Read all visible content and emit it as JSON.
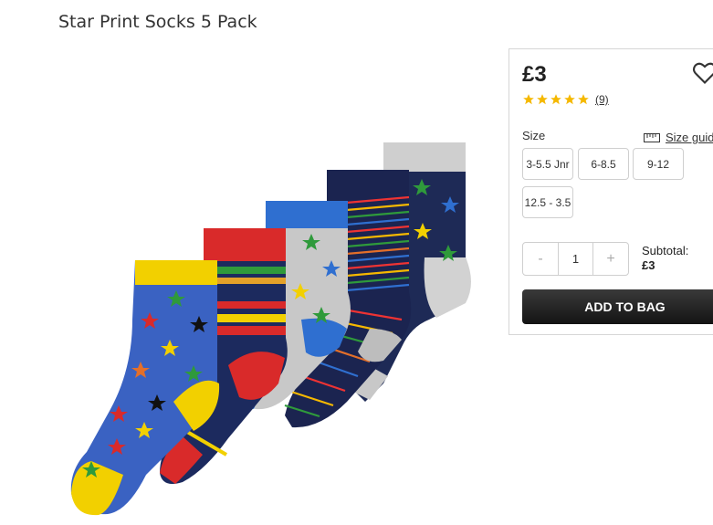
{
  "product": {
    "title": "Star Print Socks 5 Pack"
  },
  "purchase": {
    "price": "£3",
    "rating": {
      "stars": 5,
      "max": 5,
      "review_count": "(9)"
    },
    "size_label": "Size",
    "size_guide_label": "Size guide",
    "sizes": [
      "3-5.5 Jnr",
      "6-8.5",
      "9-12",
      "12.5 - 3.5"
    ],
    "quantity": "1",
    "decrement_label": "-",
    "increment_label": "+",
    "subtotal_label": "Subtotal:",
    "subtotal_value": "£3",
    "add_to_bag_label": "ADD TO BAG"
  },
  "colors": {
    "star_rating": "#f5b800",
    "button_dark": "#1e1e1e"
  }
}
